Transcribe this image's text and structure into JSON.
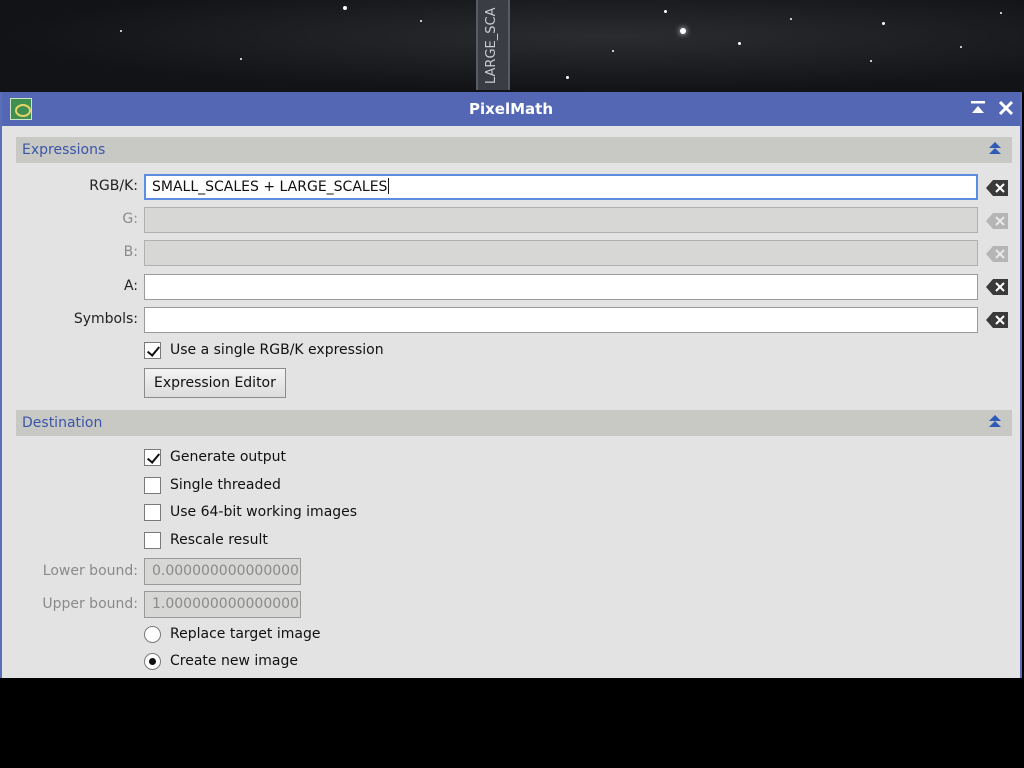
{
  "background": {
    "side_tab_label": "LARGE_SCA"
  },
  "window": {
    "title": "PixelMath",
    "title_bar_color": "#5367b4"
  },
  "expressions": {
    "section_title": "Expressions",
    "rgbk_label": "RGB/K:",
    "rgbk_value": "SMALL_SCALES + LARGE_SCALES",
    "g_label": "G:",
    "g_value": "",
    "b_label": "B:",
    "b_value": "",
    "a_label": "A:",
    "a_value": "",
    "symbols_label": "Symbols:",
    "symbols_value": "",
    "single_rgbk_label": "Use a single RGB/K expression",
    "single_rgbk_checked": true,
    "expression_editor_label": "Expression Editor"
  },
  "destination": {
    "section_title": "Destination",
    "generate_output_label": "Generate output",
    "generate_output_checked": true,
    "single_threaded_label": "Single threaded",
    "single_threaded_checked": false,
    "use_64bit_label": "Use 64-bit working images",
    "use_64bit_checked": false,
    "rescale_label": "Rescale result",
    "rescale_checked": false,
    "lower_bound_label": "Lower bound:",
    "lower_bound_value": "0.000000000000000",
    "upper_bound_label": "Upper bound:",
    "upper_bound_value": "1.000000000000000",
    "replace_target_label": "Replace target image",
    "create_new_label": "Create new image",
    "selected_target": "Create new image"
  },
  "icons": {
    "app": "pixelmath-app-icon",
    "shade": "shade-window-icon",
    "close": "close-icon",
    "collapse": "collapse-section-icon",
    "clear": "clear-field-icon"
  }
}
